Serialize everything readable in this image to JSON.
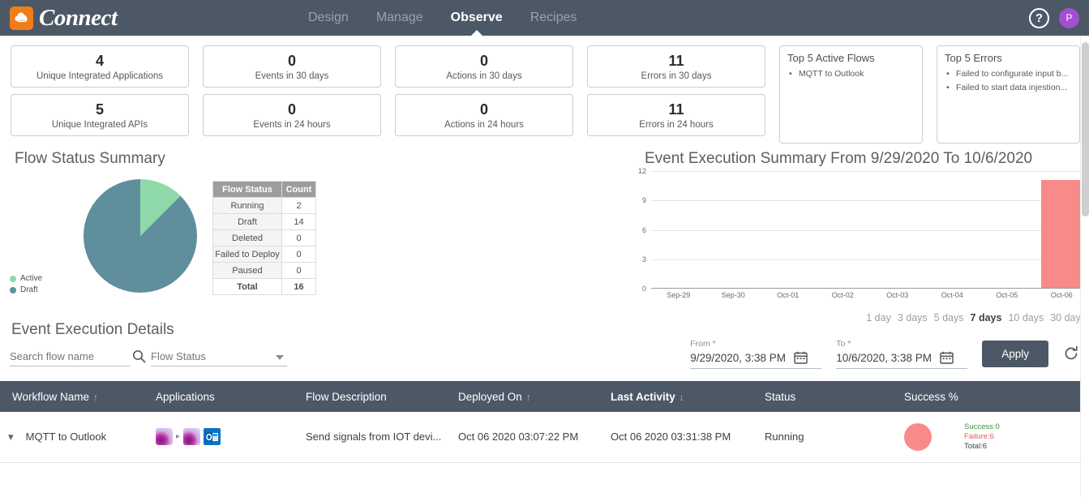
{
  "topbar": {
    "brand": "Connect",
    "logo_icon": "cloud-logo-icon",
    "nav": [
      {
        "label": "Design",
        "active": false
      },
      {
        "label": "Manage",
        "active": false
      },
      {
        "label": "Observe",
        "active": true
      },
      {
        "label": "Recipes",
        "active": false
      }
    ],
    "help_icon": "question-mark-icon",
    "help_glyph": "?",
    "avatar_initial": "P",
    "accent_brand": "#f07d1a",
    "navbar_bg": "#4c5866",
    "avatar_bg": "#a24fd0"
  },
  "stats": [
    [
      {
        "value": "4",
        "label": "Unique Integrated Applications"
      },
      {
        "value": "5",
        "label": "Unique Integrated APIs"
      }
    ],
    [
      {
        "value": "0",
        "label": "Events in 30 days"
      },
      {
        "value": "0",
        "label": "Events in 24 hours"
      }
    ],
    [
      {
        "value": "0",
        "label": "Actions in 30 days"
      },
      {
        "value": "0",
        "label": "Actions in 24 hours"
      }
    ],
    [
      {
        "value": "11",
        "label": "Errors in 30 days"
      },
      {
        "value": "11",
        "label": "Errors in 24 hours"
      }
    ]
  ],
  "top_active_flows": {
    "title": "Top 5 Active Flows",
    "items": [
      "MQTT to Outlook"
    ]
  },
  "top_errors": {
    "title": "Top 5 Errors",
    "items": [
      "Failed to configurate input b...",
      "Failed to start data injestion..."
    ]
  },
  "flow_status": {
    "title": "Flow Status Summary",
    "legend": [
      {
        "label": "Active",
        "color": "#8fd9ab"
      },
      {
        "label": "Draft",
        "color": "#5f8f9c"
      }
    ],
    "table_headers": [
      "Flow Status",
      "Count"
    ],
    "rows": [
      {
        "name": "Running",
        "count": "2"
      },
      {
        "name": "Draft",
        "count": "14"
      },
      {
        "name": "Deleted",
        "count": "0"
      },
      {
        "name": "Failed to Deploy",
        "count": "0"
      },
      {
        "name": "Paused",
        "count": "0"
      }
    ],
    "total_row": {
      "name": "Total",
      "count": "16"
    }
  },
  "chart_data": {
    "type": "bar",
    "title": "Event Execution Summary From 9/29/2020 To 10/6/2020",
    "categories": [
      "Sep-29",
      "Sep-30",
      "Oct-01",
      "Oct-02",
      "Oct-03",
      "Oct-04",
      "Oct-05",
      "Oct-06"
    ],
    "series": [
      {
        "name": "Failure",
        "color": "#f98a8a",
        "values": [
          0,
          0,
          0,
          0,
          0,
          0,
          0,
          11
        ]
      },
      {
        "name": "Success",
        "color": "#8fd9ab",
        "values": [
          0,
          0,
          0,
          0,
          0,
          0,
          0,
          0
        ]
      }
    ],
    "yticks": [
      "0",
      "3",
      "6",
      "9",
      "12"
    ],
    "ylim": [
      0,
      12
    ],
    "xlabel": "",
    "ylabel": "",
    "grid": true,
    "legend_position": "right"
  },
  "range_buttons": [
    {
      "label": "1 day",
      "active": false
    },
    {
      "label": "3 days",
      "active": false
    },
    {
      "label": "5 days",
      "active": false
    },
    {
      "label": "7 days",
      "active": true
    },
    {
      "label": "10 days",
      "active": false
    },
    {
      "label": "30 days",
      "active": false
    }
  ],
  "details": {
    "title": "Event Execution Details",
    "search_placeholder": "Search flow name",
    "search_value": "",
    "search_icon": "search-icon",
    "flow_status_placeholder": "Flow Status",
    "flow_status_value": "",
    "from_label": "From *",
    "from_value": "9/29/2020, 3:38 PM",
    "to_label": "To *",
    "to_value": "10/6/2020, 3:38 PM",
    "calendar_icon": "calendar-icon",
    "apply_label": "Apply",
    "refresh_icon": "refresh-icon"
  },
  "table": {
    "columns": [
      {
        "label": "Workflow Name",
        "sort": "↑",
        "sorted": false
      },
      {
        "label": "Applications",
        "sort": "",
        "sorted": false
      },
      {
        "label": "Flow Description",
        "sort": "",
        "sorted": false
      },
      {
        "label": "Deployed On",
        "sort": "↑",
        "sorted": false
      },
      {
        "label": "Last Activity",
        "sort": "↓",
        "sorted": true
      },
      {
        "label": "Status",
        "sort": "",
        "sorted": false
      },
      {
        "label": "Success %",
        "sort": "",
        "sorted": false
      }
    ],
    "rows": [
      {
        "expand_icon": "chevron-down-icon",
        "workflow_name": "MQTT to Outlook",
        "apps": [
          "mqtt-icon",
          "mqtt-icon",
          "outlook-icon"
        ],
        "flow_description": "Send signals from IOT devi...",
        "deployed_on": "Oct 06 2020 03:07:22 PM",
        "last_activity": "Oct 06 2020 03:31:38 PM",
        "status": "Running",
        "success_circle_color": "#f98a8a",
        "success": "Success:0",
        "failure": "Failure:6",
        "total": "Total:6"
      }
    ]
  }
}
